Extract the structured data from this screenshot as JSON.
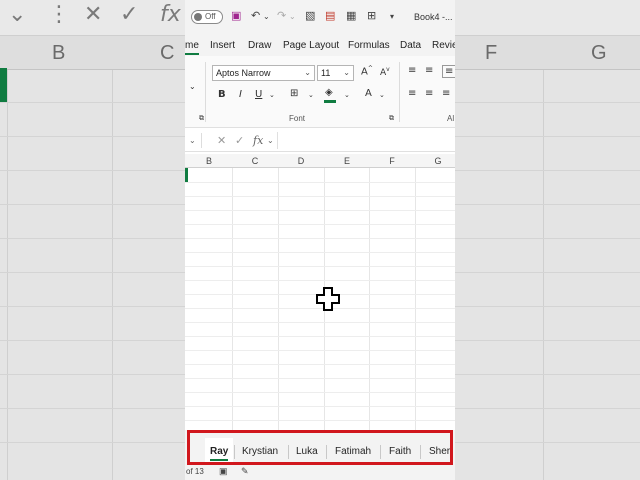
{
  "titlebar": {
    "autosave_label": "Off",
    "book_title": "Book4 -..."
  },
  "tabs": [
    {
      "label": "me",
      "active": true
    },
    {
      "label": "Insert"
    },
    {
      "label": "Draw"
    },
    {
      "label": "Page Layout"
    },
    {
      "label": "Formulas"
    },
    {
      "label": "Data"
    },
    {
      "label": "Revie"
    }
  ],
  "ribbon": {
    "font_name": "Aptos Narrow",
    "font_size": "11",
    "font_group_label": "Font",
    "alignment_group_label": "Al",
    "bold": "B",
    "italic": "I",
    "underline": "U",
    "font_color": "A"
  },
  "formula_bar": {
    "fx": "fx"
  },
  "columns": [
    "B",
    "C",
    "D",
    "E",
    "F",
    "G"
  ],
  "background": {
    "left_col": "B",
    "left_col2": "C",
    "right_col1": "F",
    "right_col2": "G",
    "fx": "fx"
  },
  "sheets": [
    {
      "label": "Ray",
      "active": true
    },
    {
      "label": "Krystian"
    },
    {
      "label": "Luka"
    },
    {
      "label": "Fatimah"
    },
    {
      "label": "Faith"
    },
    {
      "label": "Shere"
    }
  ],
  "status": {
    "sheet_count": "of 13"
  },
  "colors": {
    "accent": "#107c41",
    "highlight": "#d1171d"
  }
}
